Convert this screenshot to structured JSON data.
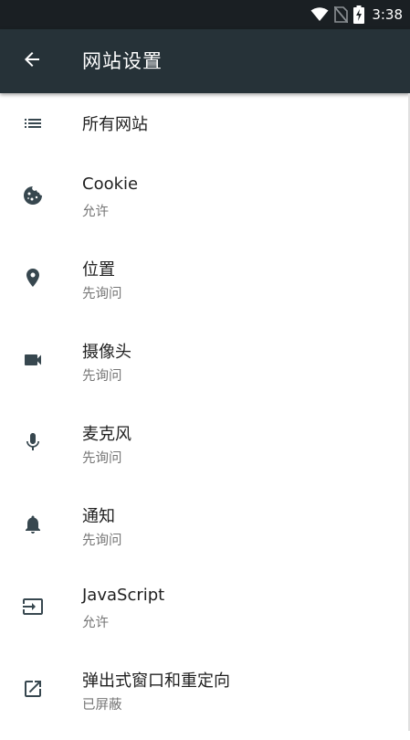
{
  "status_bar": {
    "time": "3:38",
    "icons": [
      "wifi-icon",
      "no-sim-icon",
      "battery-charging-icon"
    ]
  },
  "app_bar": {
    "back_icon": "arrow-back-icon",
    "title": "网站设置"
  },
  "settings": [
    {
      "id": "all-sites",
      "icon": "list-icon",
      "label": "所有网站",
      "status": ""
    },
    {
      "id": "cookie",
      "icon": "cookie-icon",
      "label": "Cookie",
      "status": "允许"
    },
    {
      "id": "location",
      "icon": "location-pin-icon",
      "label": "位置",
      "status": "先询问"
    },
    {
      "id": "camera",
      "icon": "videocam-icon",
      "label": "摄像头",
      "status": "先询问"
    },
    {
      "id": "microphone",
      "icon": "mic-icon",
      "label": "麦克风",
      "status": "先询问"
    },
    {
      "id": "notifications",
      "icon": "bell-icon",
      "label": "通知",
      "status": "先询问"
    },
    {
      "id": "javascript",
      "icon": "javascript-input-icon",
      "label": "JavaScript",
      "status": "允许"
    },
    {
      "id": "popups",
      "icon": "open-in-new-icon",
      "label": "弹出式窗口和重定向",
      "status": "已屏蔽"
    }
  ],
  "colors": {
    "status_bar": "#1a1f23",
    "app_bar": "#263238",
    "primary_text": "#212121",
    "secondary_text": "#757575",
    "icon": "#37474f"
  }
}
